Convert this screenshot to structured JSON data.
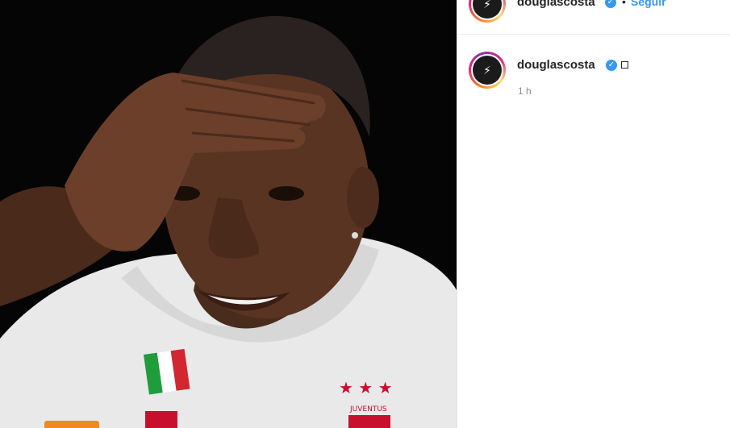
{
  "post": {
    "username": "douglascosta",
    "follow_label": "Seguir",
    "separator": "•",
    "timestamp": "1 h"
  },
  "photo": {
    "description_icon": "portrait-photo",
    "shirt_badge_text": "JUVENTUS"
  },
  "colors": {
    "accent": "#3897f0",
    "photo_background": "#050505",
    "orange_tab": "#f08a1c"
  }
}
